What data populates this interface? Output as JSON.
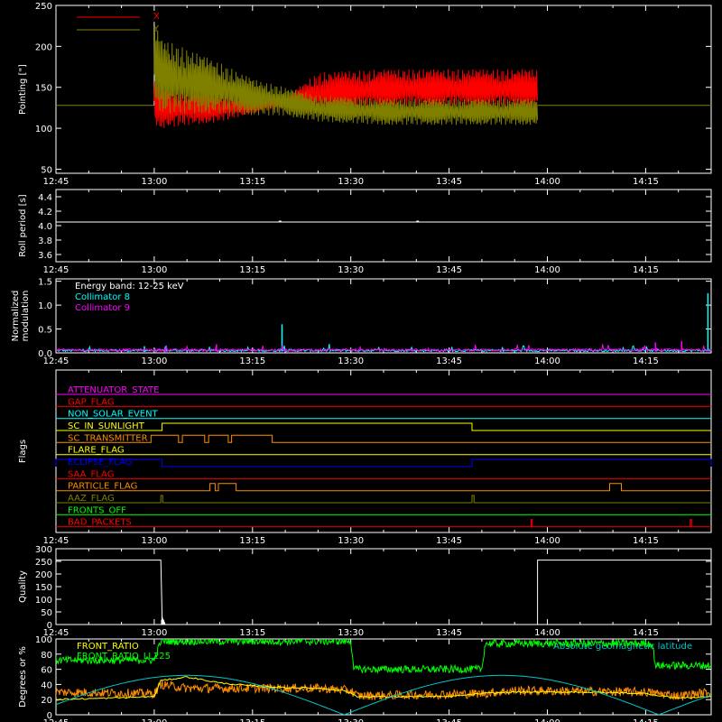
{
  "time_axis": {
    "start_min": 0,
    "end_min": 100,
    "tick_minutes": [
      0,
      15,
      30,
      45,
      60,
      75,
      90
    ],
    "tick_labels": [
      "12:45",
      "13:00",
      "13:15",
      "13:30",
      "13:45",
      "14:00",
      "14:15"
    ]
  },
  "colors": {
    "background": "#000000",
    "axes": "#ffffff",
    "x_pointing": "#ff0000",
    "y_pointing": "#808000",
    "collimator_8": "#00ffff",
    "collimator_9": "#ff00ff",
    "front_ratio": "#ffff00",
    "front_ratio_ll225": "#00ff00",
    "orange_series": "#ff8c00",
    "latitude": "#00c8c8"
  },
  "chart_data": [
    {
      "type": "line",
      "ylabel": "Pointing [\"]",
      "ylim": [
        45,
        250
      ],
      "yticks": [
        50,
        100,
        150,
        200,
        250
      ],
      "series": [
        {
          "name": "X",
          "color": "#ff0000",
          "x_range_min": [
            15,
            73.5
          ],
          "baseline": 128,
          "envelope": {
            "x_min": [
              15,
              16,
              25,
              30,
              35,
              40,
              50,
              73.5
            ],
            "lower": [
              105,
              100,
              108,
              118,
              124,
              118,
              125,
              125
            ],
            "upper": [
              160,
              150,
              142,
              136,
              138,
              168,
              172,
              172
            ]
          }
        },
        {
          "name": "Y",
          "color": "#808000",
          "x_range_min": [
            15,
            73.5
          ],
          "baseline": 128,
          "envelope": {
            "x_min": [
              15,
              16,
              25,
              30,
              35,
              40,
              50,
              73.5
            ],
            "lower": [
              140,
              118,
              118,
              116,
              115,
              108,
              104,
              104
            ],
            "upper": [
              230,
              210,
              180,
              160,
              150,
              140,
              136,
              136
            ]
          }
        }
      ],
      "legend": "top-left"
    },
    {
      "type": "line",
      "ylabel": "Roll period [s]",
      "ylim": [
        3.5,
        4.5
      ],
      "yticks": [
        "3.6",
        "3.8",
        "4.0",
        "4.2",
        "4.4"
      ],
      "series": [
        {
          "name": "",
          "values_constant": 4.05,
          "x_range_min": [
            0,
            100
          ]
        }
      ]
    },
    {
      "type": "bar",
      "ylabel": "Normalized modulation",
      "ylim": [
        0,
        1.55
      ],
      "yticks": [
        "0.0",
        "0.5",
        "1.0",
        "1.5"
      ],
      "annotation": "Energy band: 12-25 keV",
      "series": [
        {
          "name": "Collimator 8",
          "color": "#00ffff",
          "baseline": 0.05,
          "spikes": [
            {
              "t": 13.5,
              "v": 0.14
            },
            {
              "t": 34.5,
              "v": 0.6
            },
            {
              "t": 99.5,
              "v": 1.25
            }
          ]
        },
        {
          "name": "Collimator 9",
          "color": "#ff00ff",
          "baseline": 0.06,
          "spikes": [
            {
              "t": 24.5,
              "v": 0.18
            },
            {
              "t": 91.5,
              "v": 0.22
            },
            {
              "t": 95.5,
              "v": 0.25
            }
          ]
        }
      ],
      "legend": "top-left"
    },
    {
      "type": "table",
      "ylabel": "Flags",
      "flags": [
        {
          "name": "ATTENUATOR_STATE",
          "color": "#ff00ff",
          "high": []
        },
        {
          "name": "GAP_FLAG",
          "color": "#ff0000",
          "high": []
        },
        {
          "name": "NON_SOLAR_EVENT",
          "color": "#00ffff",
          "high": []
        },
        {
          "name": "SC_IN_SUNLIGHT",
          "color": "#ffff00",
          "high": [
            [
              16.2,
              63.5
            ]
          ]
        },
        {
          "name": "SC_TRANSMITTER",
          "color": "#ff8c00",
          "high": [
            [
              14.5,
              18.7
            ],
            [
              19.3,
              22.7
            ],
            [
              23.3,
              26.3
            ],
            [
              26.8,
              33
            ]
          ]
        },
        {
          "name": "FLARE_FLAG",
          "color": "#ffff00",
          "high": []
        },
        {
          "name": "ECLIPSE_FLAG",
          "color": "#0000ff",
          "high": [
            [
              0,
              16.2
            ],
            [
              63.5,
              100
            ]
          ]
        },
        {
          "name": "SAA_FLAG",
          "color": "#ff0000",
          "high": []
        },
        {
          "name": "PARTICLE_FLAG",
          "color": "#ff8c00",
          "high": [
            [
              23.5,
              24.3
            ],
            [
              24.8,
              27.5
            ],
            [
              84.5,
              86.3
            ]
          ]
        },
        {
          "name": "AAZ_FLAG",
          "color": "#808000",
          "high": [
            [
              16,
              16.3
            ],
            [
              63.5,
              63.8
            ]
          ]
        },
        {
          "name": "FRONTS_OFF",
          "color": "#00ff00",
          "high": []
        },
        {
          "name": "BAD_PACKETS",
          "color": "#ff0000",
          "high": [
            [
              72.5,
              72.7
            ],
            [
              96.8,
              97
            ]
          ]
        }
      ]
    },
    {
      "type": "line",
      "ylabel": "Quality",
      "ylim": [
        0,
        300
      ],
      "yticks": [
        "0",
        "50",
        "100",
        "150",
        "200",
        "250",
        "300"
      ],
      "series": [
        {
          "name": "",
          "steps": [
            [
              0,
              255
            ],
            [
              16,
              255
            ],
            [
              16.2,
              30
            ],
            [
              16.5,
              0
            ],
            [
              73.5,
              0
            ],
            [
              73.5,
              255
            ],
            [
              100,
              255
            ]
          ]
        }
      ]
    },
    {
      "type": "line",
      "ylabel": "Degrees or %",
      "ylim": [
        0,
        100
      ],
      "yticks": [
        "0",
        "20",
        "40",
        "60",
        "80",
        "100"
      ],
      "series": [
        {
          "name": "FRONT_RATIO",
          "color": "#ffff00",
          "points": [
            [
              0,
              20
            ],
            [
              8,
              22
            ],
            [
              15,
              24
            ],
            [
              16,
              45
            ],
            [
              20,
              50
            ],
            [
              25,
              42
            ],
            [
              30,
              38
            ],
            [
              35,
              36
            ],
            [
              40,
              35
            ],
            [
              44,
              32
            ],
            [
              46,
              24
            ],
            [
              60,
              24
            ],
            [
              65,
              28
            ],
            [
              70,
              30
            ],
            [
              80,
              30
            ],
            [
              90,
              28
            ],
            [
              95,
              22
            ],
            [
              100,
              24
            ]
          ]
        },
        {
          "name": "FRONT_RATIO_LL225",
          "color": "#00ff00",
          "points": [
            [
              0,
              72
            ],
            [
              15,
              72
            ],
            [
              16,
              97
            ],
            [
              45,
              97
            ],
            [
              45.5,
              60
            ],
            [
              65,
              60
            ],
            [
              65.5,
              94
            ],
            [
              91,
              94
            ],
            [
              91.5,
              65
            ],
            [
              100,
              65
            ]
          ]
        },
        {
          "name": "",
          "color": "#ff8c00",
          "points": [
            [
              0,
              30
            ],
            [
              15,
              28
            ],
            [
              16,
              40
            ],
            [
              20,
              35
            ],
            [
              40,
              35
            ],
            [
              45,
              32
            ],
            [
              46,
              25
            ],
            [
              65,
              28
            ],
            [
              70,
              32
            ],
            [
              90,
              30
            ],
            [
              95,
              25
            ],
            [
              100,
              30
            ]
          ]
        },
        {
          "name": "Absolute geomagnetic latitude",
          "color": "#00c8c8",
          "curve": "abs_sine",
          "amplitude": 52,
          "period_min": 48,
          "phase_min": 4
        }
      ],
      "legend": "top"
    }
  ]
}
